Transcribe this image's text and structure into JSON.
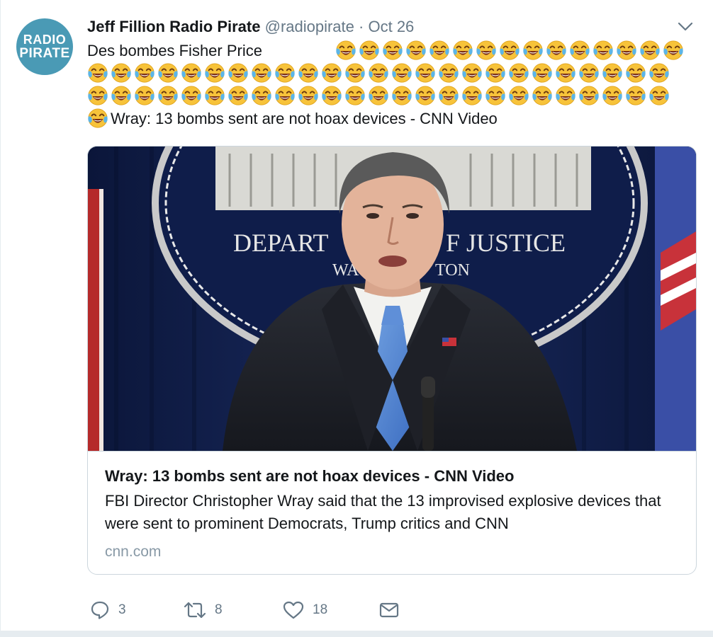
{
  "tweet": {
    "author_name": "Jeff Fillion Radio Pirate",
    "handle": "@radiopirate",
    "separator": "·",
    "date": "Oct 26",
    "avatar": {
      "line1": "RADIO",
      "line2": "PIRATE",
      "color": "#4a9ab5"
    },
    "text_line1": "Des bombes Fisher Price",
    "text_last": "Wray: 13 bombs sent are not hoax devices - CNN Video",
    "emoji": "face-with-tears-of-joy-icon"
  },
  "card": {
    "image_alt": "Christopher Wray at Department of Justice podium",
    "seal_text_1": "DEPART",
    "seal_text_2": "F JUSTICE",
    "seal_text_3": "WA",
    "seal_text_4": "TON",
    "title": "Wray: 13 bombs sent are not hoax devices - CNN Video",
    "description": "FBI Director Christopher Wray said that the 13 improvised explosive devices that were sent to prominent Democrats, Trump critics and CNN",
    "domain": "cnn.com"
  },
  "actions": {
    "reply_count": "3",
    "retweet_count": "8",
    "like_count": "18"
  },
  "colors": {
    "text": "#14171a",
    "secondary": "#657786",
    "border": "#ccd6dd"
  }
}
